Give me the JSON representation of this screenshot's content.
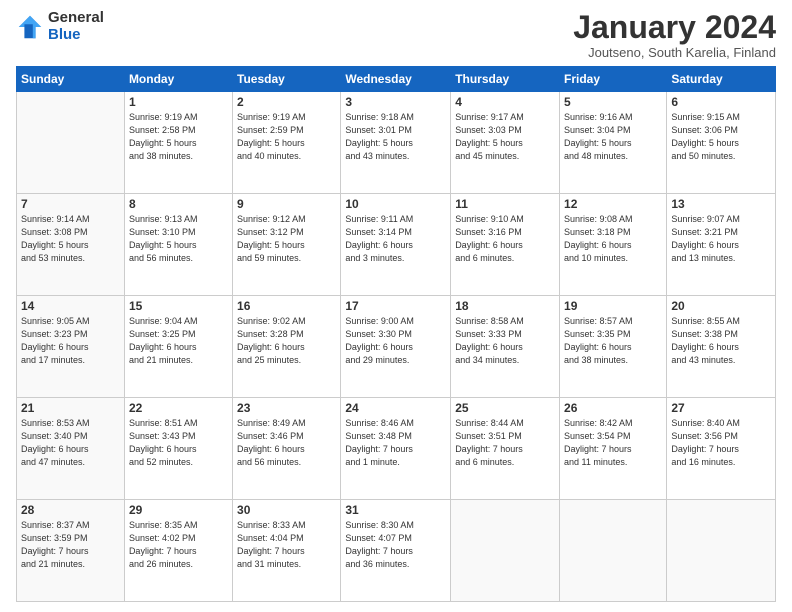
{
  "logo": {
    "general": "General",
    "blue": "Blue"
  },
  "header": {
    "title": "January 2024",
    "subtitle": "Joutseno, South Karelia, Finland"
  },
  "days_of_week": [
    "Sunday",
    "Monday",
    "Tuesday",
    "Wednesday",
    "Thursday",
    "Friday",
    "Saturday"
  ],
  "weeks": [
    [
      {
        "day": "",
        "info": ""
      },
      {
        "day": "1",
        "info": "Sunrise: 9:19 AM\nSunset: 2:58 PM\nDaylight: 5 hours\nand 38 minutes."
      },
      {
        "day": "2",
        "info": "Sunrise: 9:19 AM\nSunset: 2:59 PM\nDaylight: 5 hours\nand 40 minutes."
      },
      {
        "day": "3",
        "info": "Sunrise: 9:18 AM\nSunset: 3:01 PM\nDaylight: 5 hours\nand 43 minutes."
      },
      {
        "day": "4",
        "info": "Sunrise: 9:17 AM\nSunset: 3:03 PM\nDaylight: 5 hours\nand 45 minutes."
      },
      {
        "day": "5",
        "info": "Sunrise: 9:16 AM\nSunset: 3:04 PM\nDaylight: 5 hours\nand 48 minutes."
      },
      {
        "day": "6",
        "info": "Sunrise: 9:15 AM\nSunset: 3:06 PM\nDaylight: 5 hours\nand 50 minutes."
      }
    ],
    [
      {
        "day": "7",
        "info": "Sunrise: 9:14 AM\nSunset: 3:08 PM\nDaylight: 5 hours\nand 53 minutes."
      },
      {
        "day": "8",
        "info": "Sunrise: 9:13 AM\nSunset: 3:10 PM\nDaylight: 5 hours\nand 56 minutes."
      },
      {
        "day": "9",
        "info": "Sunrise: 9:12 AM\nSunset: 3:12 PM\nDaylight: 5 hours\nand 59 minutes."
      },
      {
        "day": "10",
        "info": "Sunrise: 9:11 AM\nSunset: 3:14 PM\nDaylight: 6 hours\nand 3 minutes."
      },
      {
        "day": "11",
        "info": "Sunrise: 9:10 AM\nSunset: 3:16 PM\nDaylight: 6 hours\nand 6 minutes."
      },
      {
        "day": "12",
        "info": "Sunrise: 9:08 AM\nSunset: 3:18 PM\nDaylight: 6 hours\nand 10 minutes."
      },
      {
        "day": "13",
        "info": "Sunrise: 9:07 AM\nSunset: 3:21 PM\nDaylight: 6 hours\nand 13 minutes."
      }
    ],
    [
      {
        "day": "14",
        "info": "Sunrise: 9:05 AM\nSunset: 3:23 PM\nDaylight: 6 hours\nand 17 minutes."
      },
      {
        "day": "15",
        "info": "Sunrise: 9:04 AM\nSunset: 3:25 PM\nDaylight: 6 hours\nand 21 minutes."
      },
      {
        "day": "16",
        "info": "Sunrise: 9:02 AM\nSunset: 3:28 PM\nDaylight: 6 hours\nand 25 minutes."
      },
      {
        "day": "17",
        "info": "Sunrise: 9:00 AM\nSunset: 3:30 PM\nDaylight: 6 hours\nand 29 minutes."
      },
      {
        "day": "18",
        "info": "Sunrise: 8:58 AM\nSunset: 3:33 PM\nDaylight: 6 hours\nand 34 minutes."
      },
      {
        "day": "19",
        "info": "Sunrise: 8:57 AM\nSunset: 3:35 PM\nDaylight: 6 hours\nand 38 minutes."
      },
      {
        "day": "20",
        "info": "Sunrise: 8:55 AM\nSunset: 3:38 PM\nDaylight: 6 hours\nand 43 minutes."
      }
    ],
    [
      {
        "day": "21",
        "info": "Sunrise: 8:53 AM\nSunset: 3:40 PM\nDaylight: 6 hours\nand 47 minutes."
      },
      {
        "day": "22",
        "info": "Sunrise: 8:51 AM\nSunset: 3:43 PM\nDaylight: 6 hours\nand 52 minutes."
      },
      {
        "day": "23",
        "info": "Sunrise: 8:49 AM\nSunset: 3:46 PM\nDaylight: 6 hours\nand 56 minutes."
      },
      {
        "day": "24",
        "info": "Sunrise: 8:46 AM\nSunset: 3:48 PM\nDaylight: 7 hours\nand 1 minute."
      },
      {
        "day": "25",
        "info": "Sunrise: 8:44 AM\nSunset: 3:51 PM\nDaylight: 7 hours\nand 6 minutes."
      },
      {
        "day": "26",
        "info": "Sunrise: 8:42 AM\nSunset: 3:54 PM\nDaylight: 7 hours\nand 11 minutes."
      },
      {
        "day": "27",
        "info": "Sunrise: 8:40 AM\nSunset: 3:56 PM\nDaylight: 7 hours\nand 16 minutes."
      }
    ],
    [
      {
        "day": "28",
        "info": "Sunrise: 8:37 AM\nSunset: 3:59 PM\nDaylight: 7 hours\nand 21 minutes."
      },
      {
        "day": "29",
        "info": "Sunrise: 8:35 AM\nSunset: 4:02 PM\nDaylight: 7 hours\nand 26 minutes."
      },
      {
        "day": "30",
        "info": "Sunrise: 8:33 AM\nSunset: 4:04 PM\nDaylight: 7 hours\nand 31 minutes."
      },
      {
        "day": "31",
        "info": "Sunrise: 8:30 AM\nSunset: 4:07 PM\nDaylight: 7 hours\nand 36 minutes."
      },
      {
        "day": "",
        "info": ""
      },
      {
        "day": "",
        "info": ""
      },
      {
        "day": "",
        "info": ""
      }
    ]
  ]
}
